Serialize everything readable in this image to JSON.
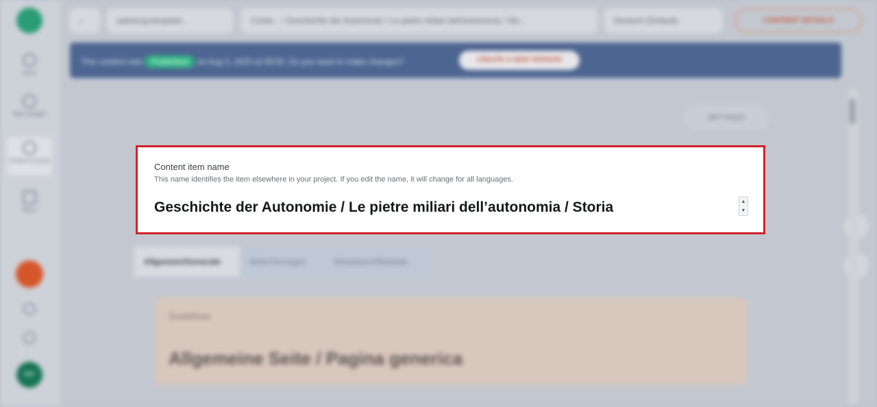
{
  "sidebar": {
    "nav": [
      {
        "label": "Home",
        "icon": "home-icon"
      },
      {
        "label": "Web spotlight",
        "icon": "globe-icon"
      },
      {
        "label": "Content & assets",
        "icon": "content-icon"
      },
      {
        "label": "Menu",
        "icon": "menu-icon"
      }
    ],
    "avatar_initials": "MH"
  },
  "topbar": {
    "project": "salzburg-template...",
    "breadcrumb": "Conte... / Geschichte der Autonomie / Le pietre miliari dell'autonomia / Sto...",
    "language": "Deutsch (Default)",
    "details_label": "CONTENT DETAILS"
  },
  "banner": {
    "prefix": "This content was",
    "status": "Published",
    "suffix": "on Aug 3, 2023 at 09:50. Do you want to make changes?",
    "button": "CREATE A NEW VERSION"
  },
  "settings_button": "SETTINGS",
  "content_name": {
    "label": "Content item name",
    "help": "This name identifies the item elsewhere in your project. If you edit the name, it will change for all languages.",
    "value": "Geschichte der Autonomie / Le pietre miliari dell’autonomia / Storia"
  },
  "lang_tabs": [
    {
      "label": "Allgemein/Generale"
    },
    {
      "label": "Bilder/Immagini"
    },
    {
      "label": "Metadaten/Metadati"
    }
  ],
  "element_card": {
    "sub": "Guidelines",
    "title": "Allgemeine Seite / Pagina generica"
  }
}
